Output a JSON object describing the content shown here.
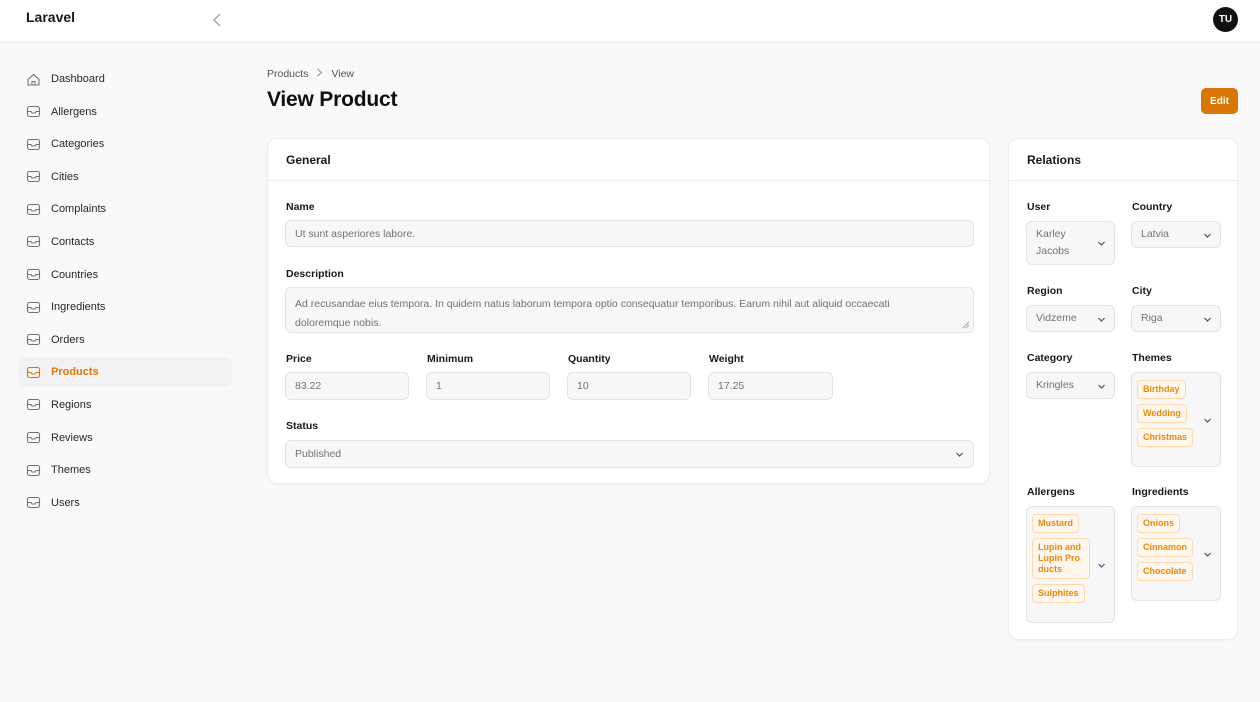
{
  "app": {
    "brand": "Laravel",
    "user_initials": "TU"
  },
  "colors": {
    "accent": "#d97706",
    "tag_text": "#ea8a0c",
    "tag_bg": "#fff7ed"
  },
  "sidebar": {
    "items": [
      {
        "label": "Dashboard",
        "icon": "home-icon"
      },
      {
        "label": "Allergens",
        "icon": "inbox-icon"
      },
      {
        "label": "Categories",
        "icon": "inbox-icon"
      },
      {
        "label": "Cities",
        "icon": "inbox-icon"
      },
      {
        "label": "Complaints",
        "icon": "inbox-icon"
      },
      {
        "label": "Contacts",
        "icon": "inbox-icon"
      },
      {
        "label": "Countries",
        "icon": "inbox-icon"
      },
      {
        "label": "Ingredients",
        "icon": "inbox-icon"
      },
      {
        "label": "Orders",
        "icon": "inbox-icon"
      },
      {
        "label": "Products",
        "icon": "inbox-icon",
        "active": true
      },
      {
        "label": "Regions",
        "icon": "inbox-icon"
      },
      {
        "label": "Reviews",
        "icon": "inbox-icon"
      },
      {
        "label": "Themes",
        "icon": "inbox-icon"
      },
      {
        "label": "Users",
        "icon": "inbox-icon"
      }
    ]
  },
  "breadcrumb": {
    "parent": "Products",
    "current": "View"
  },
  "page": {
    "title": "View Product",
    "edit_label": "Edit"
  },
  "general": {
    "heading": "General",
    "name_label": "Name",
    "name_value": "Ut sunt asperiores labore.",
    "description_label": "Description",
    "description_value": "Ad recusandae eius tempora. In quidem natus laborum tempora optio consequatur temporibus. Earum nihil aut aliquid occaecati doloremque nobis.",
    "price_label": "Price",
    "price_value": "83.22",
    "minimum_label": "Minimum",
    "minimum_value": "1",
    "quantity_label": "Quantity",
    "quantity_value": "10",
    "weight_label": "Weight",
    "weight_value": "17.25",
    "status_label": "Status",
    "status_value": "Published"
  },
  "relations": {
    "heading": "Relations",
    "user_label": "User",
    "user_line1": "Karley",
    "user_line2": "Jacobs",
    "country_label": "Country",
    "country_value": "Latvia",
    "region_label": "Region",
    "region_value": "Vidzeme",
    "city_label": "City",
    "city_value": "Riga",
    "category_label": "Category",
    "category_value": "Kringles",
    "themes_label": "Themes",
    "themes": [
      "Birthday",
      "Wedding",
      "Christmas"
    ],
    "allergens_label": "Allergens",
    "allergens": [
      "Mustard",
      "Lupin and Lupin Products",
      "Sulphites"
    ],
    "ingredients_label": "Ingredients",
    "ingredients": [
      "Onions",
      "Cinnamon",
      "Chocolate"
    ]
  }
}
